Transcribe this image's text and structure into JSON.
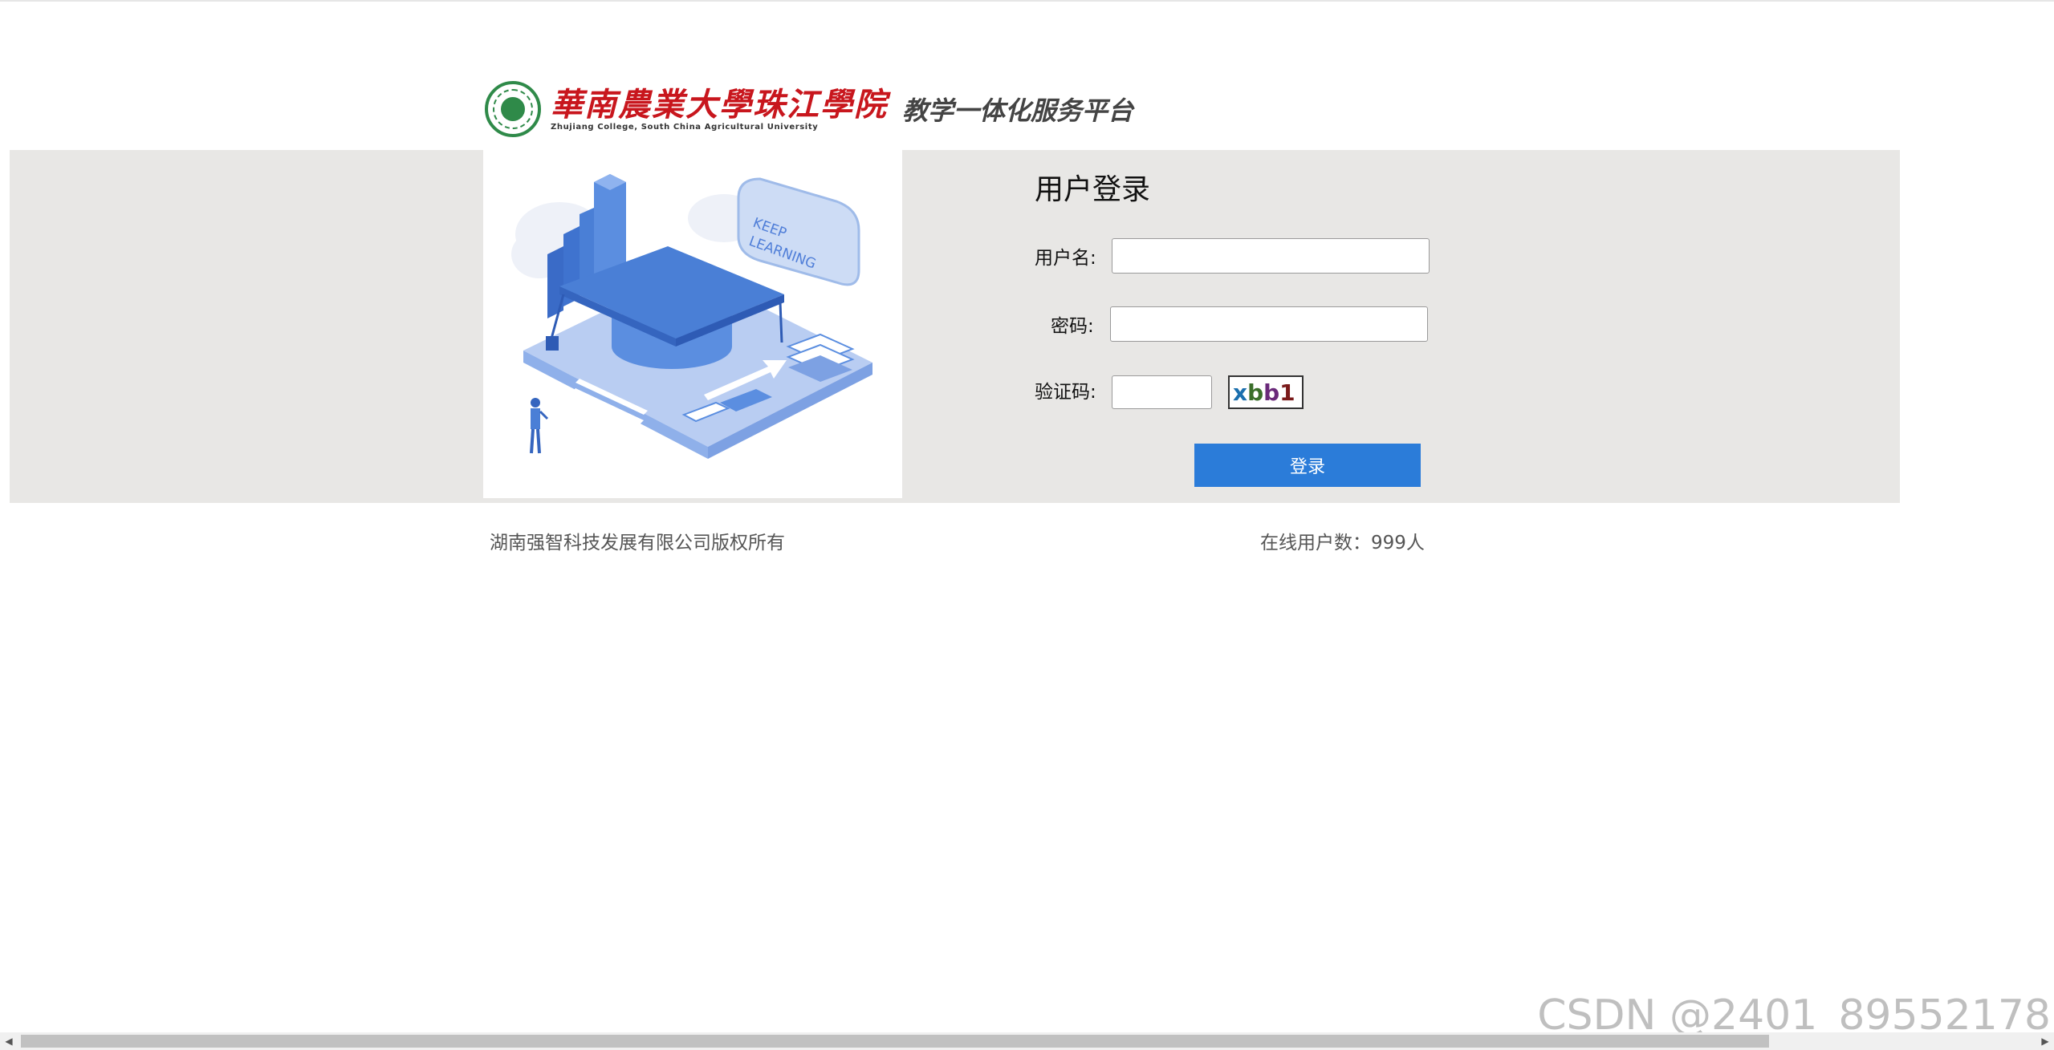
{
  "header": {
    "logo_cn": "華南農業大學珠江學院",
    "logo_en": "Zhujiang College, South China Agricultural University",
    "platform_title": "教学一体化服务平台"
  },
  "illustration": {
    "caption": "KEEP LEARNING"
  },
  "login": {
    "title": "用户登录",
    "username_label": "用户名:",
    "username_value": "",
    "password_label": "密码:",
    "password_value": "",
    "captcha_label": "验证码:",
    "captcha_value": "",
    "captcha_image_text": "xbb1",
    "submit_label": "登录"
  },
  "footer": {
    "copyright": "湖南强智科技发展有限公司版权所有",
    "online_users": "在线用户数：999人"
  },
  "watermark": "CSDN @2401_89552178",
  "colors": {
    "brand_red": "#c8161d",
    "seal_green": "#2f8a49",
    "button_blue": "#2b7cd9",
    "band_gray": "#e8e7e5"
  }
}
